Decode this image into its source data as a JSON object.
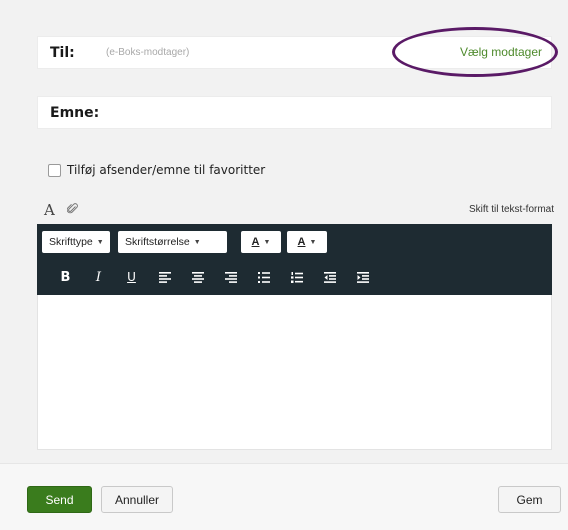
{
  "to": {
    "label": "Til:",
    "placeholder": "(e-Boks-modtager)",
    "choose_label": "Vælg modtager"
  },
  "subject": {
    "label": "Emne:"
  },
  "favorites": {
    "label": "Tilføj afsender/emne til favoritter",
    "checked": false
  },
  "editor_tabs": {
    "font_tab_glyph": "A",
    "switch_format": "Skift til tekst-format"
  },
  "toolbar": {
    "font_label": "Skrifttype",
    "size_label": "Skriftstørrelse",
    "text_color_glyph": "A",
    "bg_color_glyph": "A",
    "bold": "B",
    "italic": "I",
    "underline": "U"
  },
  "footer": {
    "send": "Send",
    "cancel": "Annuller",
    "save": "Gem"
  },
  "colors": {
    "toolbar_bg": "#1e2b32",
    "accent_green": "#3a7c1d",
    "link_green": "#4e8a2c",
    "highlight_ring": "#5a1a66"
  }
}
